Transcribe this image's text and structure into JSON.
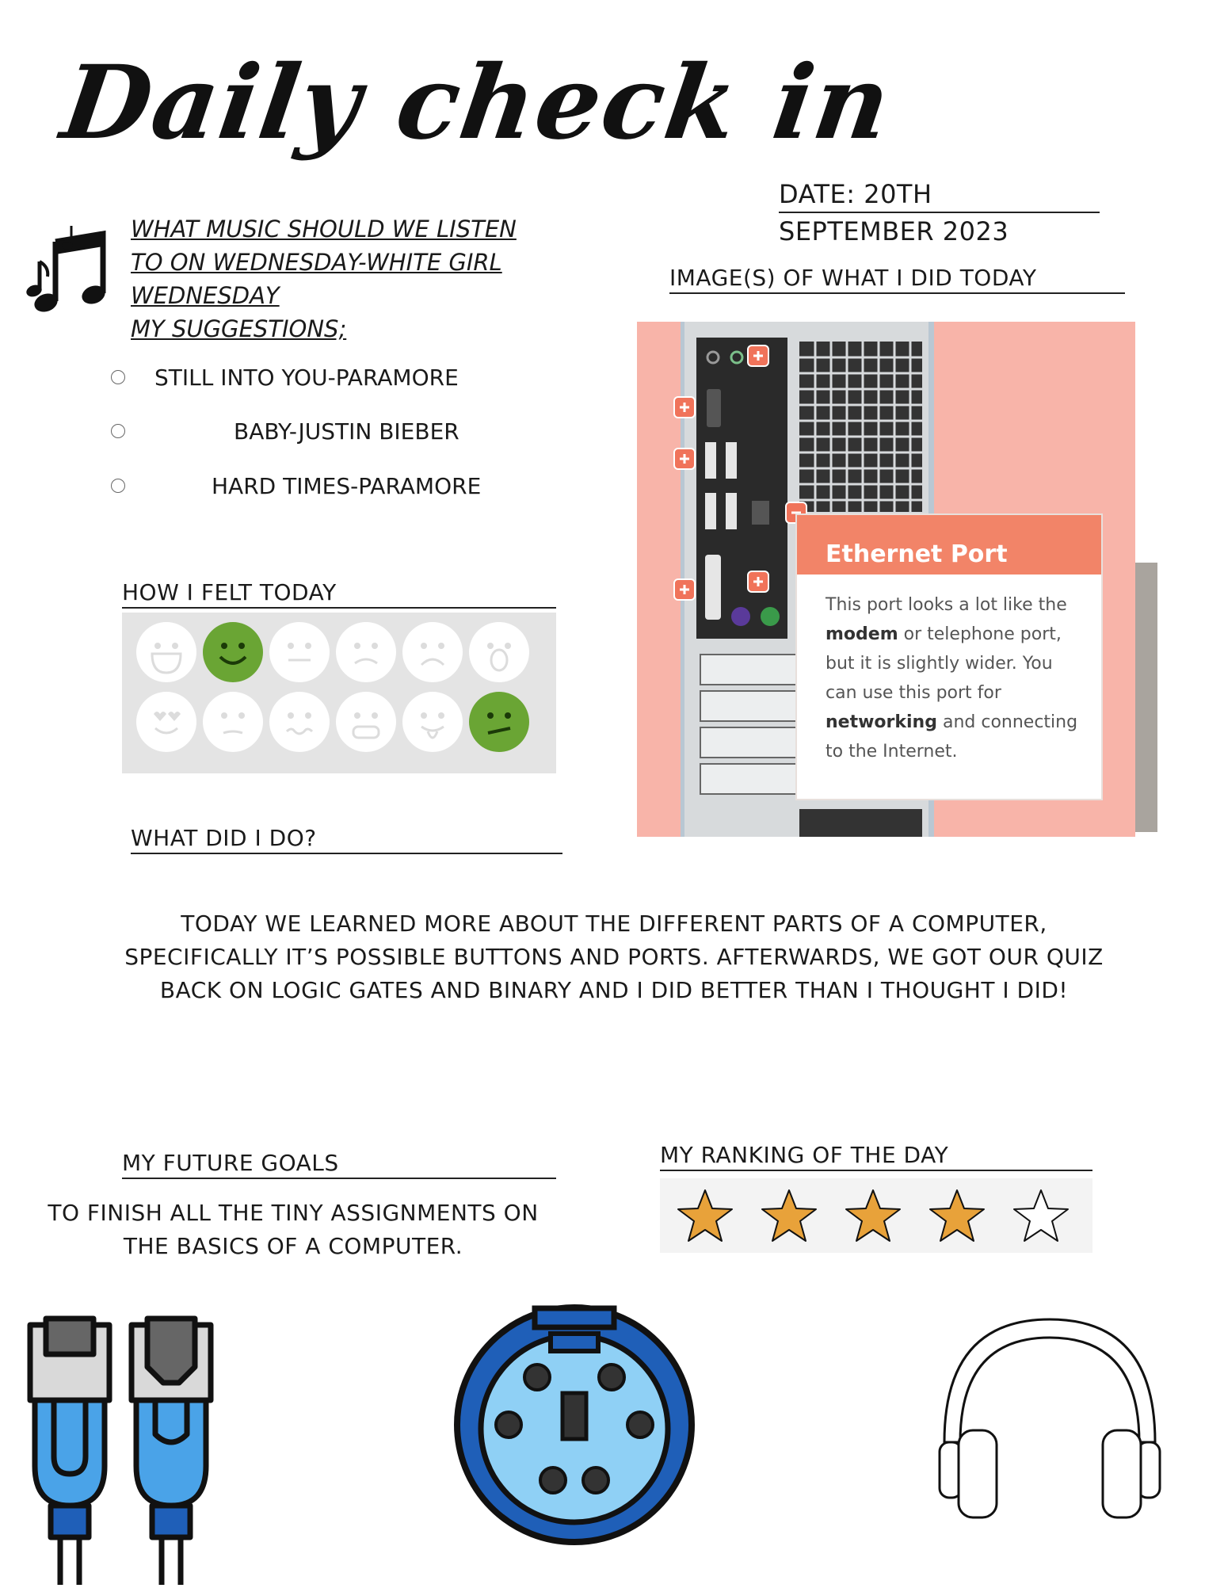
{
  "title": "Daily check in",
  "date": {
    "line1": "DATE: 20TH",
    "line2": "SEPTEMBER 2023"
  },
  "images_heading": "IMAGE(S) OF WHAT I DID  TODAY",
  "music": {
    "icon": "music-notes-icon",
    "question_l1": "WHAT MUSIC SHOULD WE LISTEN",
    "question_l2": "TO ON WEDNESDAY-WHITE GIRL",
    "question_l3": "WEDNESDAY",
    "question_l4": "MY SUGGESTIONS;",
    "songs": [
      "STILL INTO YOU-PARAMORE",
      "BABY-JUSTIN BIEBER",
      "HARD TIMES-PARAMORE"
    ]
  },
  "mood": {
    "heading": "HOW I FELT TODAY",
    "faces": [
      "laughing",
      "smile",
      "neutral",
      "worried",
      "sad",
      "shocked",
      "love",
      "skeptical",
      "wavy",
      "angry",
      "tongue",
      "uneasy"
    ],
    "selected": [
      1,
      11
    ],
    "selected_color": "#6aa534"
  },
  "what_did_i_do": {
    "heading": "WHAT DID I DO?",
    "text": "TODAY WE LEARNED MORE ABOUT THE DIFFERENT PARTS OF A COMPUTER, SPECIFICALLY IT’S POSSIBLE BUTTONS AND PORTS.  AFTERWARDS, WE GOT OUR QUIZ BACK ON LOGIC GATES AND BINARY AND I DID BETTER THAN I THOUGHT I DID!"
  },
  "photo": {
    "popup_title": "Ethernet Port",
    "popup_l1": "This port looks a lot like the",
    "popup_l2a": "modem",
    "popup_l2b": " or telephone port,",
    "popup_l3": "but it is slightly wider. You",
    "popup_l4": "can use this port for",
    "popup_l5a": "networking",
    "popup_l5b": " and connecting",
    "popup_l6": "to the Internet."
  },
  "goals": {
    "heading": "MY FUTURE GOALS",
    "text_l1": "TO FINISH ALL THE TINY ASSIGNMENTS ON",
    "text_l2": "THE BASICS OF A COMPUTER."
  },
  "ranking": {
    "heading": "MY RANKING OF THE DAY",
    "value": 4,
    "max": 5,
    "star_color": "#e8a23a"
  },
  "bottom_icons": [
    "ethernet-cables-icon",
    "ps2-port-icon",
    "headphones-icon"
  ]
}
